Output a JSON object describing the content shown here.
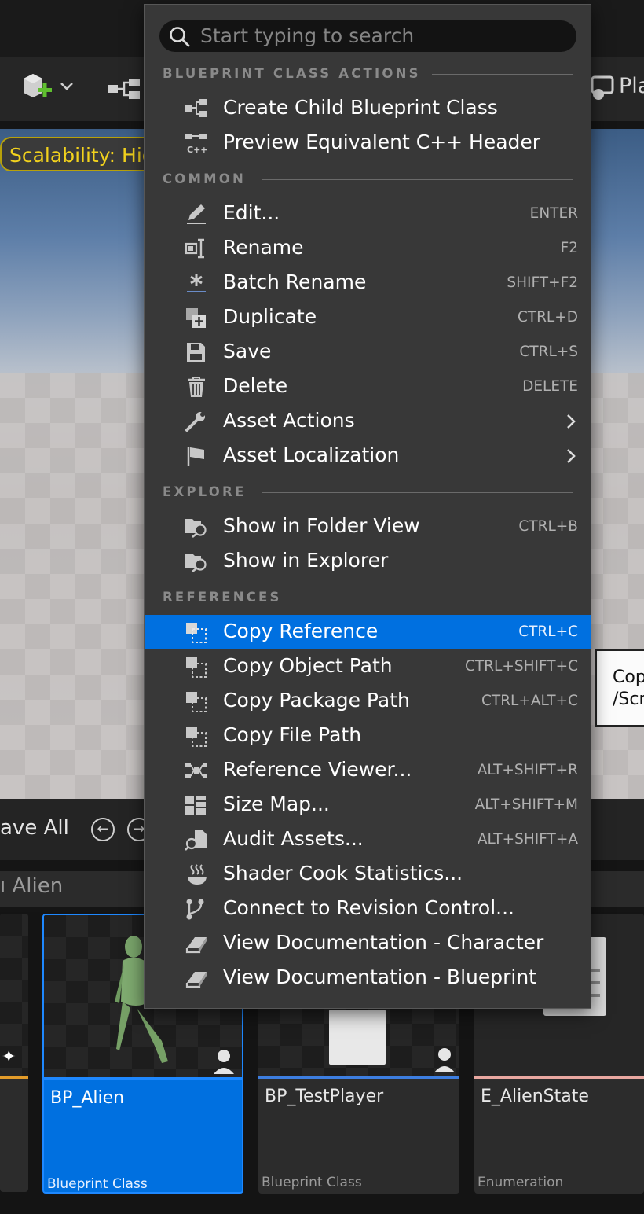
{
  "search": {
    "placeholder": "Start typing to search"
  },
  "toolbar": {
    "play_label_partial": "Pla"
  },
  "viewport": {
    "scalability_label": "Scalability: Hig"
  },
  "tooltip": {
    "line1": "Cop",
    "line2": "/Scr"
  },
  "content_browser": {
    "save_all_label": "ave All",
    "filter_text": "Alien",
    "filter_prefix": "ı"
  },
  "assets": [
    {
      "name": "BP_Alien",
      "type": "Blueprint Class",
      "selected": true
    },
    {
      "name": "BP_TestPlayer",
      "type": "Blueprint Class",
      "selected": false
    },
    {
      "name": "E_AlienState",
      "type": "Enumeration",
      "selected": false
    }
  ],
  "menu": {
    "sections": [
      {
        "title": "BLUEPRINT CLASS ACTIONS"
      },
      {
        "title": "COMMON"
      },
      {
        "title": "EXPLORE"
      },
      {
        "title": "REFERENCES"
      }
    ],
    "items": [
      {
        "label": "Create Child Blueprint Class",
        "shortcut": "",
        "icon": "blueprint-child-icon"
      },
      {
        "label": "Preview Equivalent C++ Header",
        "shortcut": "",
        "icon": "cpp-header-icon"
      },
      {
        "label": "Edit...",
        "shortcut": "ENTER",
        "icon": "pencil-icon"
      },
      {
        "label": "Rename",
        "shortcut": "F2",
        "icon": "rename-icon"
      },
      {
        "label": "Batch Rename",
        "shortcut": "SHIFT+F2",
        "icon": "batch-rename-icon"
      },
      {
        "label": "Duplicate",
        "shortcut": "CTRL+D",
        "icon": "duplicate-icon"
      },
      {
        "label": "Save",
        "shortcut": "CTRL+S",
        "icon": "save-icon"
      },
      {
        "label": "Delete",
        "shortcut": "DELETE",
        "icon": "trash-icon"
      },
      {
        "label": "Asset Actions",
        "shortcut": "",
        "icon": "wrench-icon",
        "submenu": true
      },
      {
        "label": "Asset Localization",
        "shortcut": "",
        "icon": "flag-icon",
        "submenu": true
      },
      {
        "label": "Show in Folder View",
        "shortcut": "CTRL+B",
        "icon": "folder-search-icon"
      },
      {
        "label": "Show in Explorer",
        "shortcut": "",
        "icon": "folder-search-icon"
      },
      {
        "label": "Copy Reference",
        "shortcut": "CTRL+C",
        "icon": "copy-icon",
        "highlighted": true
      },
      {
        "label": "Copy Object Path",
        "shortcut": "CTRL+SHIFT+C",
        "icon": "copy-icon"
      },
      {
        "label": "Copy Package Path",
        "shortcut": "CTRL+ALT+C",
        "icon": "copy-icon"
      },
      {
        "label": "Copy File Path",
        "shortcut": "",
        "icon": "copy-icon"
      },
      {
        "label": "Reference Viewer...",
        "shortcut": "ALT+SHIFT+R",
        "icon": "reference-viewer-icon"
      },
      {
        "label": "Size Map...",
        "shortcut": "ALT+SHIFT+M",
        "icon": "size-map-icon"
      },
      {
        "label": "Audit Assets...",
        "shortcut": "ALT+SHIFT+A",
        "icon": "audit-icon"
      },
      {
        "label": "Shader Cook Statistics...",
        "shortcut": "",
        "icon": "shader-steam-icon"
      },
      {
        "label": "Connect to Revision Control...",
        "shortcut": "",
        "icon": "branch-icon"
      },
      {
        "label": "View Documentation - Character",
        "shortcut": "",
        "icon": "book-icon"
      },
      {
        "label": "View Documentation - Blueprint",
        "shortcut": "",
        "icon": "book-icon"
      }
    ]
  },
  "colors": {
    "highlight": "#0070e0",
    "menu_bg": "#383838",
    "scalability_text": "#f2d21d",
    "selected_tile": "#0070e0",
    "blueprint_bar": "#3d7ee0",
    "enum_bar": "#e8a7a0"
  }
}
